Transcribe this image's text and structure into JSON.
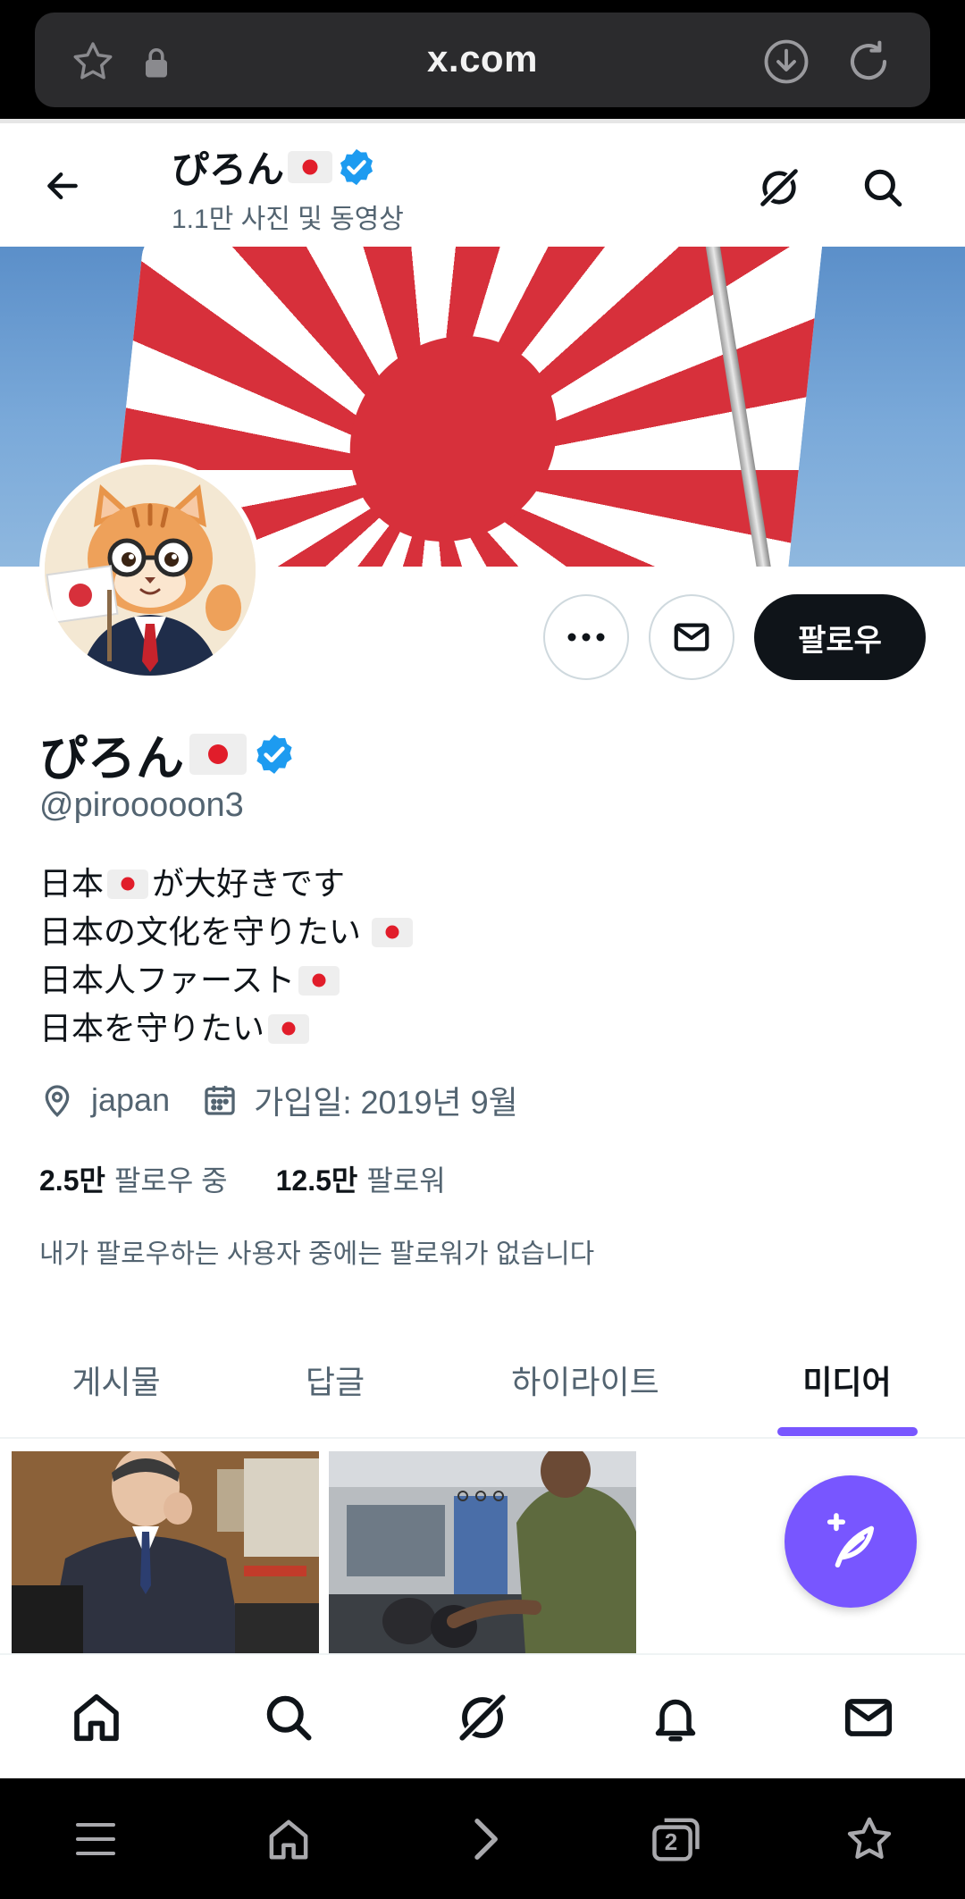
{
  "browser": {
    "url": "x.com",
    "tab_count": "2"
  },
  "header": {
    "display_name": "ぴろん",
    "subtitle": "1.1만 사진 및 동영상"
  },
  "profile": {
    "display_name": "ぴろん",
    "handle": "@pirooooon3",
    "bio": [
      "日本",
      "が大好きです",
      "日本の文化を守りたい",
      "日本人ファースト",
      "日本を守りたい"
    ],
    "location": "japan",
    "joined": "가입일: 2019년 9월",
    "following_count": "2.5만",
    "following_label": "팔로우 중",
    "followers_count": "12.5만",
    "followers_label": "팔로워",
    "followers_you_know": "내가 팔로우하는 사용자 중에는 팔로워가 없습니다",
    "follow_label": "팔로우"
  },
  "tabs": [
    "게시물",
    "답글",
    "하이라이트",
    "미디어"
  ],
  "active_tab": "미디어",
  "colors": {
    "accent": "#7856ff",
    "verified": "#1d9bf0",
    "text": "#0f1419",
    "secondary": "#536471",
    "flag_red": "#e11d2a"
  },
  "icons": {
    "back": "arrow-left-icon",
    "grok": "grok-icon",
    "search": "search-icon",
    "more": "more-icon",
    "message": "mail-icon",
    "location": "location-pin-icon",
    "calendar": "calendar-icon",
    "compose": "compose-post-icon"
  }
}
